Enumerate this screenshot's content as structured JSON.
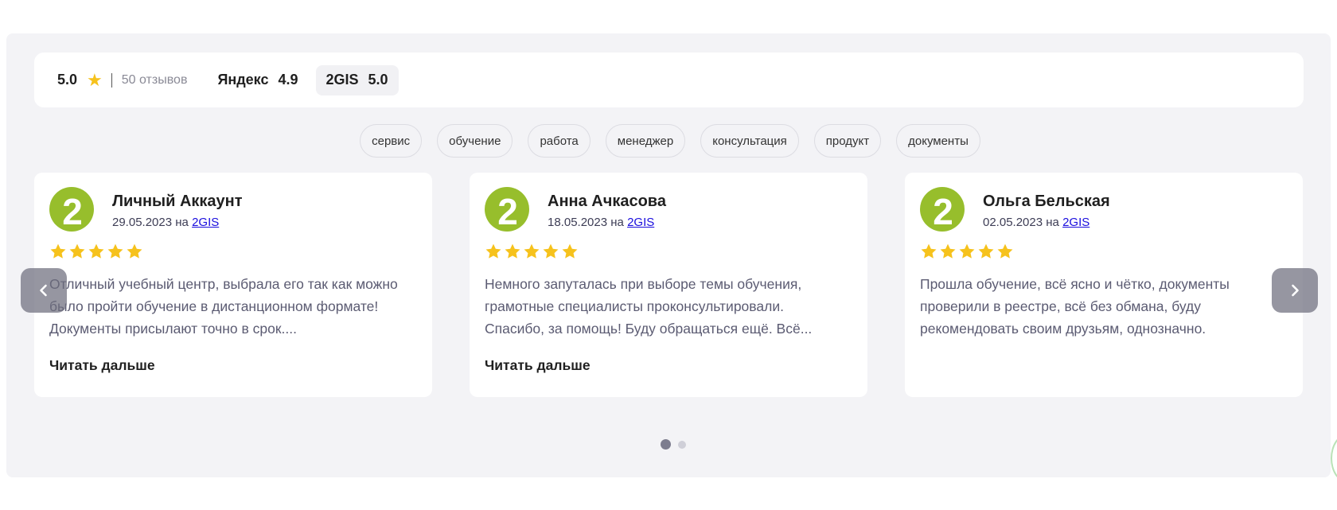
{
  "summary": {
    "rating": "5.0",
    "reviews_count": "50 отзывов",
    "sources": [
      {
        "name": "Яндекс",
        "rating": "4.9"
      },
      {
        "name": "2GIS",
        "rating": "5.0"
      }
    ]
  },
  "tags": [
    "сервис",
    "обучение",
    "работа",
    "менеджер",
    "консультация",
    "продукт",
    "документы"
  ],
  "reviews": [
    {
      "author": "Личный Аккаунт",
      "date": "29.05.2023",
      "on": "на",
      "source": "2GIS",
      "stars": 5,
      "text": "Отличный учебный центр, выбрала его так как можно было пройти обучение в дистанционном формате! Документы присылают точно в срок....",
      "read_more": "Читать дальше"
    },
    {
      "author": "Анна Ачкасова",
      "date": "18.05.2023",
      "on": "на",
      "source": "2GIS",
      "stars": 5,
      "text": "Немного запуталась при выборе темы обучения, грамотные специалисты проконсультировали. Спасибо, за помощь! Буду обращаться ещё. Всё...",
      "read_more": "Читать дальше"
    },
    {
      "author": "Ольга Бельская",
      "date": "02.05.2023",
      "on": "на",
      "source": "2GIS",
      "stars": 5,
      "text": "Прошла обучение, всё ясно и чётко, документы проверили в реестре, всё без обмана, буду рекомендовать своим друзьям, однозначно.",
      "read_more": ""
    }
  ],
  "pagination": {
    "total": 2,
    "active": 1
  },
  "colors": {
    "star": "#f6c21c",
    "avatar": "#97be2c",
    "link": "#1a0dde",
    "panel": "#f3f3f6"
  },
  "icons": {
    "prev": "chevron-left-icon",
    "next": "chevron-right-icon",
    "avatar": "2gis-logo-icon"
  }
}
